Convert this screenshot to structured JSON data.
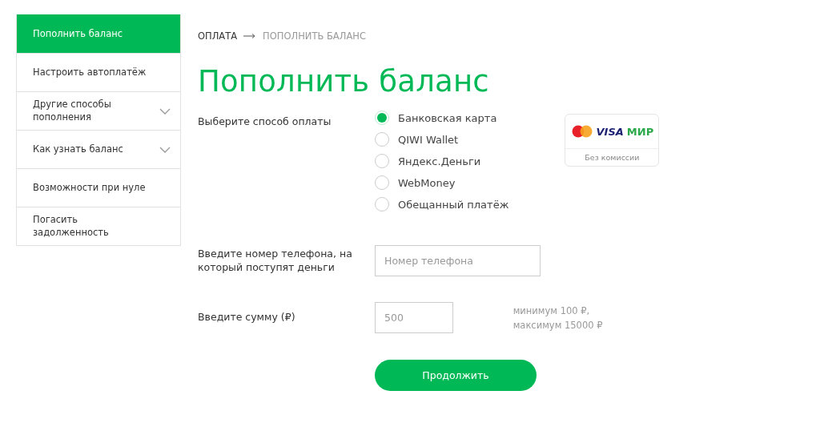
{
  "sidebar": {
    "items": [
      {
        "label": "Пополнить баланс",
        "selected": true,
        "kind": "link"
      },
      {
        "label": "Настроить автоплатёж",
        "selected": false,
        "kind": "link"
      },
      {
        "label": "Другие способы пополнения",
        "selected": false,
        "kind": "group"
      },
      {
        "label": "Как узнать баланс",
        "selected": false,
        "kind": "group"
      },
      {
        "label": "Возможности при нуле",
        "selected": false,
        "kind": "link"
      },
      {
        "label": "Погасить задолженность",
        "selected": false,
        "kind": "link"
      }
    ]
  },
  "breadcrumb": [
    "ОПЛАТА",
    "ПОПОЛНИТЬ БАЛАНС"
  ],
  "title": "Пополнить баланс",
  "payment": {
    "label": "Выберите способ оплаты",
    "options": [
      {
        "label": "Банковская карта",
        "selected": true
      },
      {
        "label": "QIWI Wallet",
        "selected": false
      },
      {
        "label": "Яндекс.Деньги",
        "selected": false
      },
      {
        "label": "WebMoney",
        "selected": false
      },
      {
        "label": "Обещанный платёж",
        "selected": false
      }
    ],
    "card_badge": {
      "visa": "VISA",
      "mir": "МИР",
      "note": "Без комиссии"
    }
  },
  "phone": {
    "label": "Введите номер телефона, на который поступят деньги",
    "placeholder": "Номер телефона"
  },
  "amount": {
    "label": "Введите сумму (₽)",
    "placeholder": "500",
    "hint": "минимум 100 ₽, максимум 15000 ₽"
  },
  "submit": "Продолжить"
}
